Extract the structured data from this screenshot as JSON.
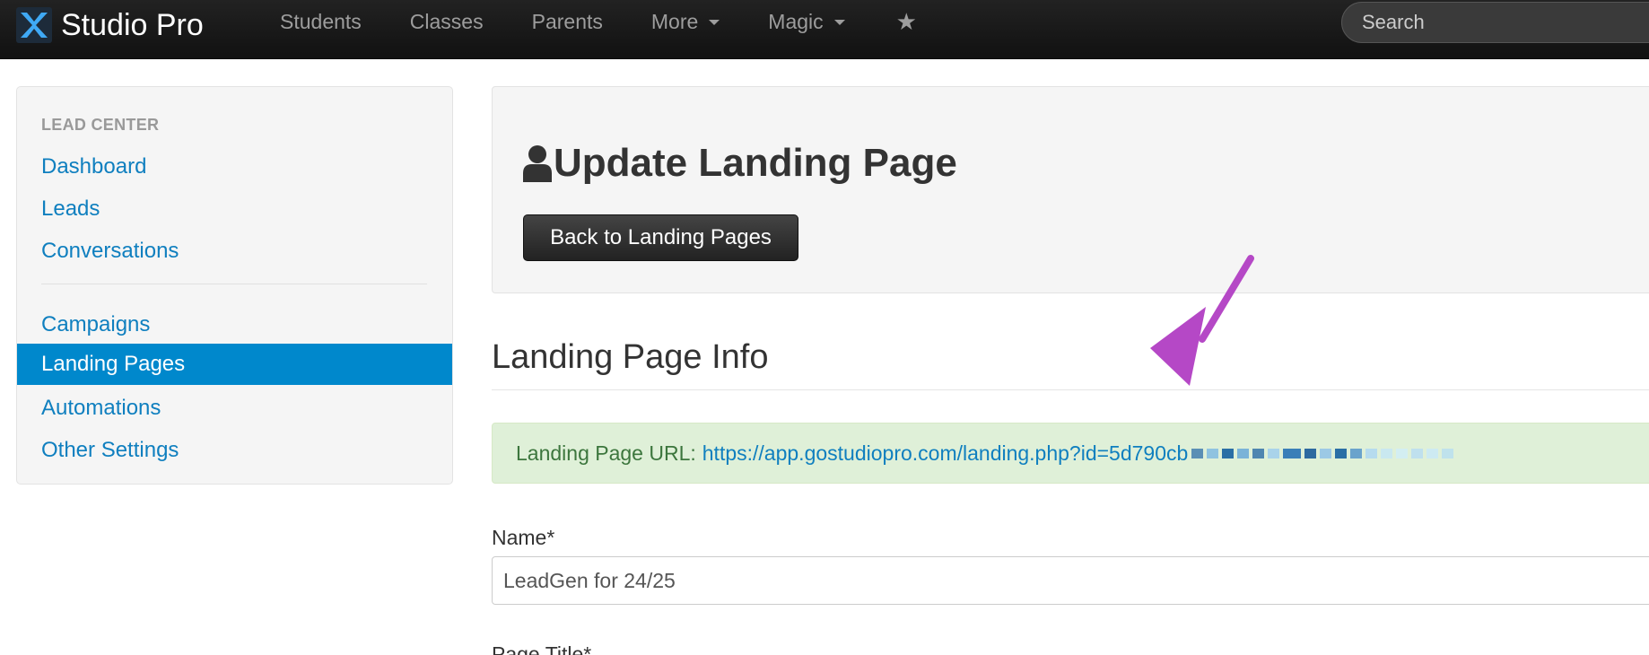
{
  "navbar": {
    "brand": "Studio Pro",
    "items": [
      {
        "label": "Students",
        "dropdown": false
      },
      {
        "label": "Classes",
        "dropdown": false
      },
      {
        "label": "Parents",
        "dropdown": false
      },
      {
        "label": "More",
        "dropdown": true
      },
      {
        "label": "Magic",
        "dropdown": true
      }
    ],
    "star_icon": "star-icon",
    "search_placeholder": "Search"
  },
  "sidebar": {
    "header": "LEAD CENTER",
    "items": [
      {
        "label": "Dashboard",
        "active": false
      },
      {
        "label": "Leads",
        "active": false
      },
      {
        "label": "Conversations",
        "active": false
      },
      {
        "label": "Campaigns",
        "active": false
      },
      {
        "label": "Landing Pages",
        "active": true
      },
      {
        "label": "Automations",
        "active": false
      },
      {
        "label": "Other Settings",
        "active": false
      }
    ]
  },
  "header": {
    "title": "Update Landing Page",
    "title_icon": "user-icon",
    "back_button": "Back to Landing Pages"
  },
  "section": {
    "title": "Landing Page Info",
    "url_label": "Landing Page URL:",
    "url_value": "https://app.gostudiopro.com/landing.php?id=5d790cb"
  },
  "form": {
    "name_label": "Name*",
    "name_value": "LeadGen for 24/25",
    "page_title_label": "Page Title*"
  },
  "colors": {
    "accent": "#0088cc",
    "link": "#0f7fbf",
    "alert_bg": "#dff0d8",
    "alert_text": "#3c763d",
    "annotation_arrow": "#b548c6"
  }
}
